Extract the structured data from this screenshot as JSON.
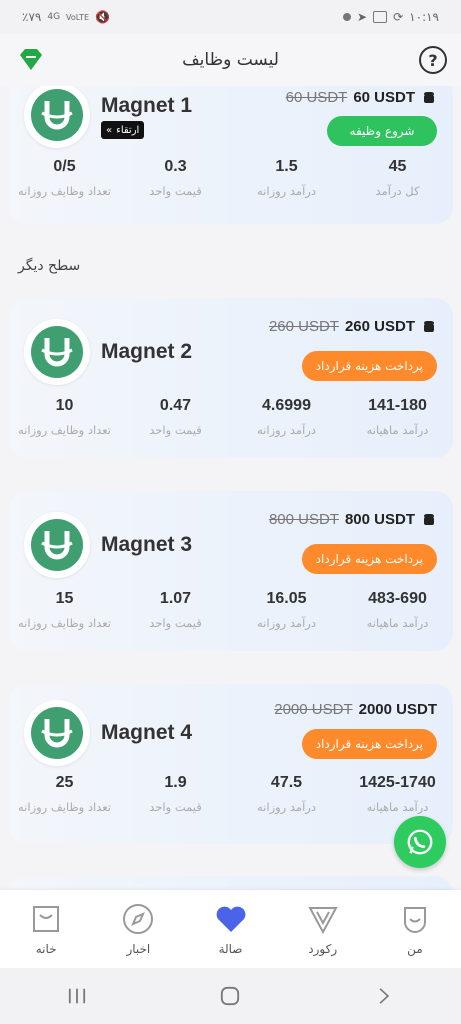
{
  "status": {
    "left": "٪۷۹",
    "network": "4G",
    "volte": "VoLTE",
    "time": "۱۰:۱۹"
  },
  "header": {
    "title": "لیست وظایف",
    "help": "?"
  },
  "section": {
    "other_level": "سطح دیگر"
  },
  "cards": [
    {
      "name": "Magnet 1",
      "old_price": "60 USDT",
      "new_price": "60 USDT",
      "badge": "ارتقاء",
      "button": "شروع وظیفه",
      "stats": [
        {
          "value": "45",
          "label": "کل درآمد"
        },
        {
          "value": "1.5",
          "label": "درآمد روزانه"
        },
        {
          "value": "0.3",
          "label": "قیمت واحد"
        },
        {
          "value": "0/5",
          "label": "تعداد وظایف روزانه"
        }
      ]
    },
    {
      "name": "Magnet 2",
      "old_price": "260 USDT",
      "new_price": "260 USDT",
      "button": "پرداخت هزینه قرارداد",
      "stats": [
        {
          "value": "141-180",
          "label": "درآمد ماهیانه"
        },
        {
          "value": "4.6999",
          "label": "درآمد روزانه"
        },
        {
          "value": "0.47",
          "label": "قیمت واحد"
        },
        {
          "value": "10",
          "label": "تعداد وظایف روزانه"
        }
      ]
    },
    {
      "name": "Magnet 3",
      "old_price": "800 USDT",
      "new_price": "800 USDT",
      "button": "پرداخت هزینه قرارداد",
      "stats": [
        {
          "value": "483-690",
          "label": "درآمد ماهیانه"
        },
        {
          "value": "16.05",
          "label": "درآمد روزانه"
        },
        {
          "value": "1.07",
          "label": "قیمت واحد"
        },
        {
          "value": "15",
          "label": "تعداد وظایف روزانه"
        }
      ]
    },
    {
      "name": "Magnet 4",
      "old_price": "2000 USDT",
      "new_price": "2000 USDT",
      "button": "پرداخت هزینه قرارداد",
      "stats": [
        {
          "value": "1425-1740",
          "label": "درآمد ماهیانه"
        },
        {
          "value": "47.5",
          "label": "درآمد روزانه"
        },
        {
          "value": "1.9",
          "label": "قیمت واحد"
        },
        {
          "value": "25",
          "label": "تعداد وظایف روزانه"
        }
      ]
    }
  ],
  "tabs": [
    {
      "label": "من",
      "icon": "profile-icon"
    },
    {
      "label": "رکورد",
      "icon": "record-icon"
    },
    {
      "label": "صالة",
      "icon": "hall-heart-icon"
    },
    {
      "label": "اخبار",
      "icon": "compass-icon"
    },
    {
      "label": "خانه",
      "icon": "home-icon"
    }
  ],
  "colors": {
    "green": "#2fc35f",
    "orange": "#ff8a2b",
    "accent": "#4a63e8"
  }
}
